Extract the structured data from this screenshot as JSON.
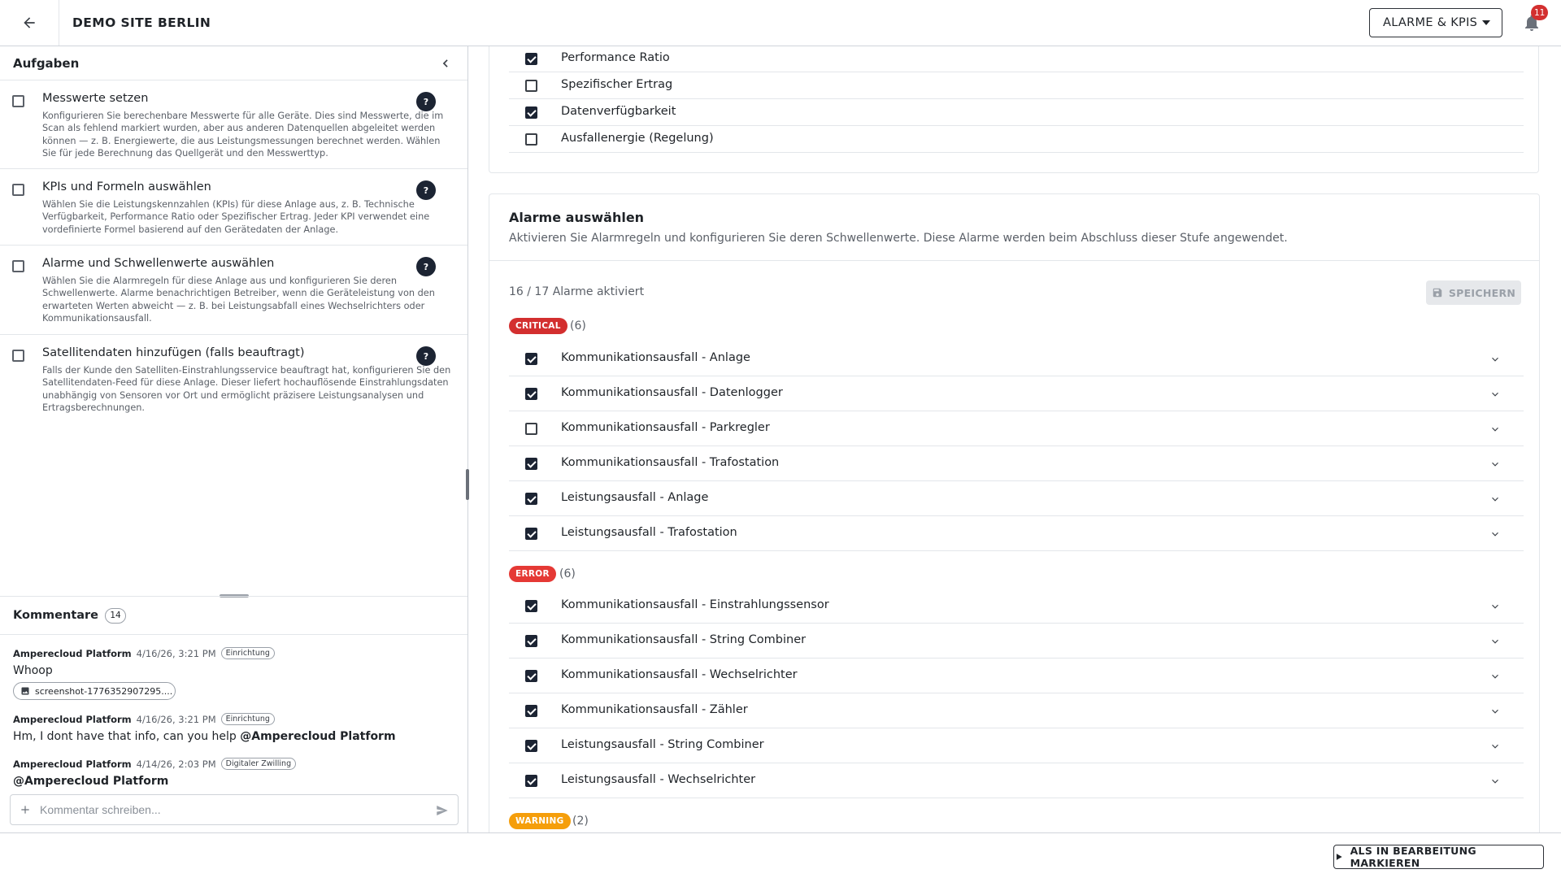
{
  "header": {
    "site_title": "DEMO SITE BERLIN",
    "stage_select": "ALARME & KPIS",
    "notification_count": "11"
  },
  "left": {
    "tasks_title": "Aufgaben",
    "tasks": [
      {
        "title": "Messwerte setzen",
        "description": "Konfigurieren Sie berechenbare Messwerte für alle Geräte. Dies sind Messwerte, die im Scan als fehlend markiert wurden, aber aus anderen Datenquellen abgeleitet werden können — z. B. Energiewerte, die aus Leistungsmessungen berechnet werden. Wählen Sie für jede Berechnung das Quellgerät und den Messwerttyp.",
        "help": "?"
      },
      {
        "title": "KPIs und Formeln auswählen",
        "description": "Wählen Sie die Leistungskennzahlen (KPIs) für diese Anlage aus, z. B. Technische Verfügbarkeit, Performance Ratio oder Spezifischer Ertrag. Jeder KPI verwendet eine vordefinierte Formel basierend auf den Gerätedaten der Anlage.",
        "help": "?"
      },
      {
        "title": "Alarme und Schwellenwerte auswählen",
        "description": "Wählen Sie die Alarmregeln für diese Anlage aus und konfigurieren Sie deren Schwellenwerte. Alarme benachrichtigen Betreiber, wenn die Geräteleistung von den erwarteten Werten abweicht — z. B. bei Leistungsabfall eines Wechselrichters oder Kommunikationsausfall.",
        "help": "?"
      },
      {
        "title": "Satellitendaten hinzufügen (falls beauftragt)",
        "description": "Falls der Kunde den Satelliten-Einstrahlungsservice beauftragt hat, konfigurieren Sie den Satellitendaten-Feed für diese Anlage. Dieser liefert hochauflösende Einstrahlungsdaten unabhängig von Sensoren vor Ort und ermöglicht präzisere Leistungsanalysen und Ertragsberechnungen.",
        "help": "?"
      }
    ],
    "comments_title": "Kommentare",
    "comments_count": "14",
    "comments": [
      {
        "author": "Amperecloud Platform",
        "date": "4/16/26, 3:21 PM",
        "tag": "Einrichtung",
        "text": "Whoop",
        "attachment": "screenshot-1776352907295...."
      },
      {
        "author": "Amperecloud Platform",
        "date": "4/16/26, 3:21 PM",
        "tag": "Einrichtung",
        "text": "Hm, I dont have that info, can you help ",
        "mention": "@Amperecloud Platform"
      },
      {
        "author": "Amperecloud Platform",
        "date": "4/14/26, 2:03 PM",
        "tag": "Digitaler Zwilling",
        "mention": "@Amperecloud Platform"
      }
    ],
    "comment_placeholder": "Kommentar schreiben..."
  },
  "kpis": [
    {
      "label": "Performance Ratio",
      "checked": true
    },
    {
      "label": "Spezifischer Ertrag",
      "checked": false
    },
    {
      "label": "Datenverfügbarkeit",
      "checked": true
    },
    {
      "label": "Ausfallenergie (Regelung)",
      "checked": false
    }
  ],
  "alarms": {
    "title": "Alarme auswählen",
    "subtitle": "Aktivieren Sie Alarmregeln und konfigurieren Sie deren Schwellenwerte. Diese Alarme werden beim Abschluss dieser Stufe angewendet.",
    "activated": "16 / 17 Alarme aktiviert",
    "save_label": "SPEICHERN",
    "groups": [
      {
        "severity": "CRITICAL",
        "color": "#d32f2f",
        "count": "(6)",
        "items": [
          {
            "label": "Kommunikationsausfall - Anlage",
            "checked": true
          },
          {
            "label": "Kommunikationsausfall - Datenlogger",
            "checked": true
          },
          {
            "label": "Kommunikationsausfall - Parkregler",
            "checked": false
          },
          {
            "label": "Kommunikationsausfall - Trafostation",
            "checked": true
          },
          {
            "label": "Leistungsausfall - Anlage",
            "checked": true
          },
          {
            "label": "Leistungsausfall - Trafostation",
            "checked": true
          }
        ]
      },
      {
        "severity": "ERROR",
        "color": "#e53935",
        "count": "(6)",
        "items": [
          {
            "label": "Kommunikationsausfall - Einstrahlungssensor",
            "checked": true
          },
          {
            "label": "Kommunikationsausfall - String Combiner",
            "checked": true
          },
          {
            "label": "Kommunikationsausfall - Wechselrichter",
            "checked": true
          },
          {
            "label": "Kommunikationsausfall - Zähler",
            "checked": true
          },
          {
            "label": "Leistungsausfall - String Combiner",
            "checked": true
          },
          {
            "label": "Leistungsausfall - Wechselrichter",
            "checked": true
          }
        ]
      },
      {
        "severity": "WARNING",
        "color": "#f59e0b",
        "count": "(2)",
        "items": []
      }
    ]
  },
  "footer": {
    "mark_button": "ALS IN BEARBEITUNG MARKIEREN"
  }
}
